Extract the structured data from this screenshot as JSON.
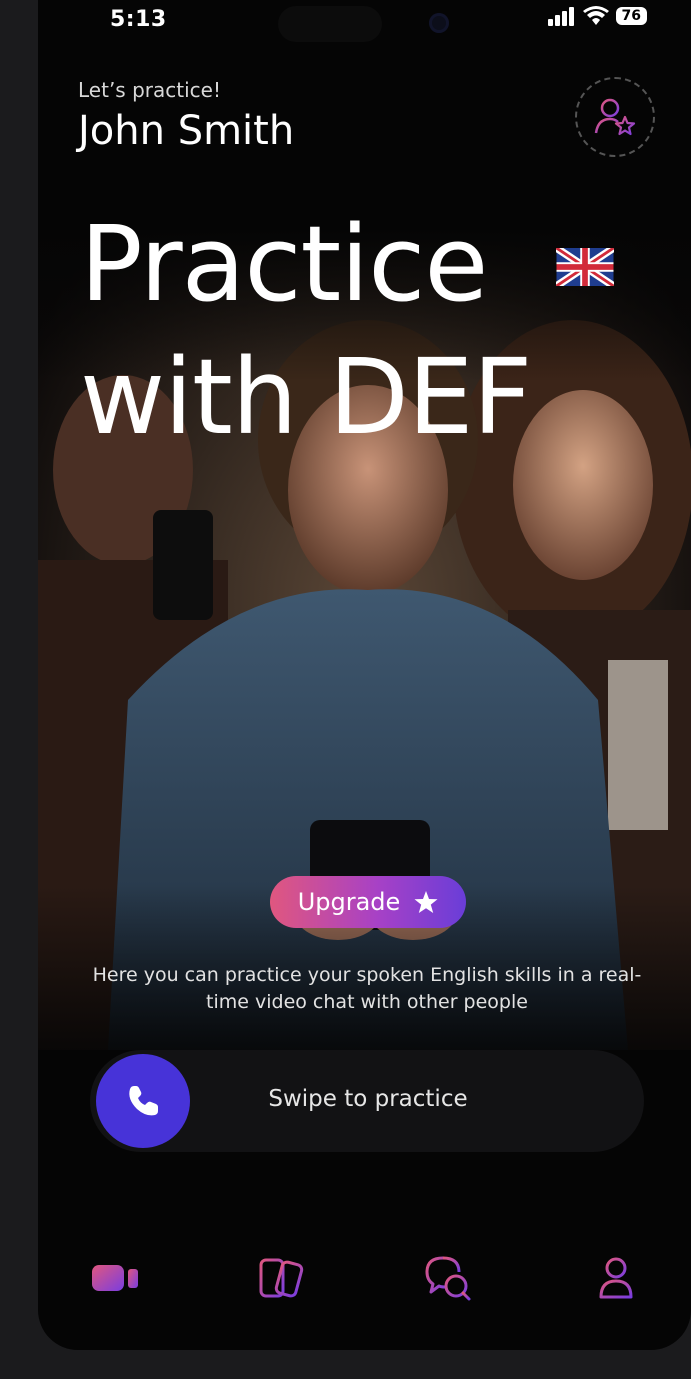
{
  "status_bar": {
    "time": "5:13",
    "battery": "76",
    "icons": [
      "signal-icon",
      "wifi-icon",
      "battery-icon"
    ]
  },
  "header": {
    "greeting": "Let’s practice!",
    "name": "John Smith",
    "avatar_icon": "user-star-icon"
  },
  "hero": {
    "line1": "Practice",
    "line2": "with DEF",
    "flag_icon": "uk-flag-icon"
  },
  "upgrade": {
    "label": "Upgrade",
    "icon": "star-icon"
  },
  "description": "Here you can practice your spoken English skills in a real-time video chat with other people",
  "swipe": {
    "label": "Swipe to practice",
    "icon": "phone-icon"
  },
  "nav": {
    "items": [
      "video-icon",
      "cards-icon",
      "chat-icon",
      "profile-icon"
    ],
    "active": "video-icon"
  },
  "colors": {
    "accent": "#4733d8",
    "gradient_start": "#e0577f",
    "gradient_end": "#6a3dd8",
    "background": "#050505"
  }
}
